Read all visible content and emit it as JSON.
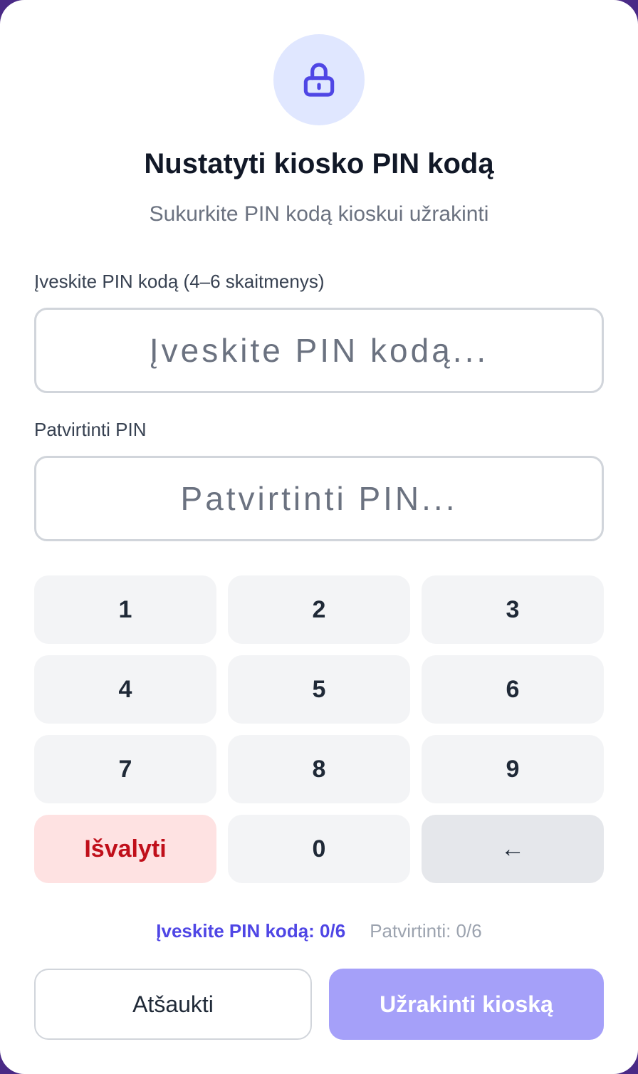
{
  "dialog": {
    "icon": "lock-icon",
    "title": "Nustatyti kiosko PIN kodą",
    "subtitle": "Sukurkite PIN kodą kioskui užrakinti"
  },
  "pin_field": {
    "label": "Įveskite PIN kodą (4–6 skaitmenys)",
    "placeholder": "Įveskite PIN kodą...",
    "value": ""
  },
  "confirm_field": {
    "label": "Patvirtinti PIN",
    "placeholder": "Patvirtinti PIN...",
    "value": ""
  },
  "keypad": {
    "keys": [
      "1",
      "2",
      "3",
      "4",
      "5",
      "6",
      "7",
      "8",
      "9"
    ],
    "clear_label": "Išvalyti",
    "zero_label": "0",
    "backspace_label": "←"
  },
  "status": {
    "pin_progress": "Įveskite PIN kodą: 0/6",
    "confirm_progress": "Patvirtinti: 0/6"
  },
  "actions": {
    "cancel_label": "Atšaukti",
    "lock_label": "Užrakinti kioską"
  },
  "colors": {
    "accent": "#4f46e5",
    "accent_disabled": "#a5a0f9",
    "danger": "#c00f1a",
    "danger_bg": "#fee2e2"
  }
}
